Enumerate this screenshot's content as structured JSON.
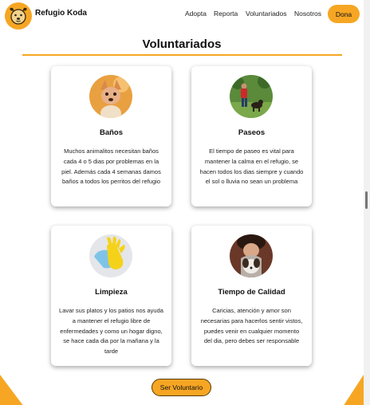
{
  "header": {
    "brand": "Refugio Koda",
    "nav": [
      "Adopta",
      "Reporta",
      "Voluntariados",
      "Nosotros"
    ],
    "donate_label": "Dona",
    "logo_icon": "dog-face-icon"
  },
  "main": {
    "title": "Voluntariados",
    "cards": [
      {
        "title": "Baños",
        "text": "Muchos animalitos necesitan baños cada 4 o 5 dias por problemas en la piel. Además cada 4 semanas damos baños a todos los perritos del refugio",
        "image": "chihuahua-photo"
      },
      {
        "title": "Paseos",
        "text": "El tiempo de paseo es vital para mantener la calma en el refugio, se hacen todos los dias siempre y cuando el sol o lluvia no sean un problema",
        "image": "dog-walking-photo"
      },
      {
        "title": "Limpieza",
        "text": "Lavar sus platos y los patios nos ayuda a mantener el refugio libre de enfermedades y como un hogar digno, se hace cada dia por la mañana y la tarde",
        "image": "cleaning-glove-photo"
      },
      {
        "title": "Tiempo de Calidad",
        "text": "Caricias, atención y amor son necesarias para hacerlos sentir vistos, puedes venir en cualquier momento del dia, pero debes ser responsable",
        "image": "hugging-dog-photo"
      }
    ],
    "cta_label": "Ser Voluntario"
  },
  "colors": {
    "accent": "#f6a623",
    "text": "#111111",
    "background": "#ffffff"
  }
}
